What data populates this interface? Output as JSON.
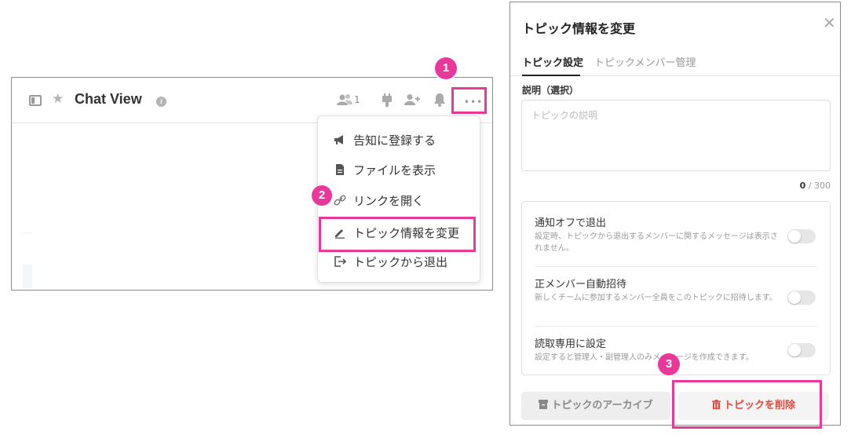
{
  "chat_view": {
    "title": "Chat View",
    "member_count": "1",
    "more_label": "•••"
  },
  "menu": {
    "items": [
      {
        "label": "告知に登録する",
        "icon": "megaphone-icon"
      },
      {
        "label": "ファイルを表示",
        "icon": "file-icon"
      },
      {
        "label": "リンクを開く",
        "icon": "link-icon"
      },
      {
        "label": "トピック情報を変更",
        "icon": "pencil-icon"
      },
      {
        "label": "トピックから退出",
        "icon": "exit-icon"
      }
    ]
  },
  "steps": {
    "one": "1",
    "two": "2",
    "three": "3"
  },
  "dialog": {
    "title": "トピック情報を変更",
    "tabs": [
      {
        "label": "トピック設定",
        "active": true
      },
      {
        "label": "トピックメンバー管理",
        "active": false
      }
    ],
    "description_label": "説明（選択）",
    "description_placeholder": "トピックの説明",
    "description_value": "",
    "counter_current": "0",
    "counter_max": " / 300",
    "options": [
      {
        "title": "通知オフで退出",
        "description": "設定時、トピックから退出するメンバーに関するメッセージは表示されません。",
        "enabled": false
      },
      {
        "title": "正メンバー自動招待",
        "description": "新しくチームに参加するメンバー全員をこのトピックに招待します。",
        "enabled": false
      },
      {
        "title": "読取専用に設定",
        "description": "設定すると管理人・副管理人のみメッセージを作成できます。",
        "enabled": false
      }
    ],
    "archive_button": "トピックのアーカイブ",
    "delete_button": "トピックを削除"
  },
  "colors": {
    "highlight": "#e8389a",
    "delete": "#e8483a"
  }
}
